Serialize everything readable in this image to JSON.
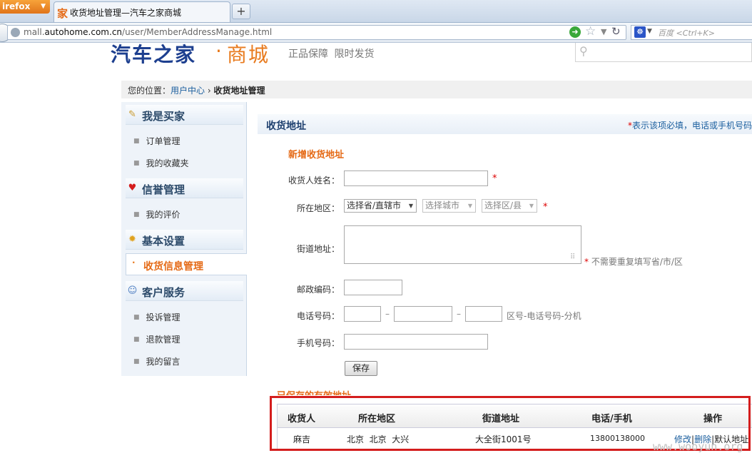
{
  "browser": {
    "menu_button": "irefox",
    "tab_title": "收货地址管理—汽车之家商城",
    "tab_favicon": "家",
    "new_tab": "+",
    "url_prefix": "mall.",
    "url_domain": "autohome.com.cn",
    "url_path": "/user/MemberAddressManage.html",
    "search_placeholder": "百度 <Ctrl+K>"
  },
  "header": {
    "logo_main": "汽车之家",
    "logo_dot": "·",
    "logo_sub": "商城",
    "slogan": "正品保障 限时发货"
  },
  "breadcrumb": {
    "prefix": "您的位置：",
    "link": "用户中心",
    "sep": " › ",
    "current": "收货地址管理"
  },
  "sidebar": {
    "sections": [
      {
        "title": "我是买家",
        "icon": "buyer-icon",
        "items": [
          "订单管理",
          "我的收藏夹"
        ]
      },
      {
        "title": "信誉管理",
        "icon": "heart-icon",
        "items": [
          "我的评价"
        ]
      },
      {
        "title": "基本设置",
        "icon": "settings-icon",
        "items": []
      },
      {
        "title": "客户服务",
        "icon": "service-icon",
        "items": [
          "投诉管理",
          "退款管理",
          "我的留言"
        ]
      }
    ],
    "active_item": "收货信息管理"
  },
  "panel": {
    "title": "收货地址",
    "note_star": "*",
    "note": "表示该项必填，电话或手机号码",
    "new_address_title": "新增收货地址",
    "form": {
      "name_label": "收货人姓名：",
      "region_label": "所在地区：",
      "province": "选择省/直辖市",
      "city": "选择城市",
      "district": "选择区/县",
      "street_label": "街道地址：",
      "street_note": "不需要重复填写省/市/区",
      "zip_label": "邮政编码：",
      "phone_label": "电话号码：",
      "phone_hint": "区号-电话号码-分机",
      "phone_dash": "–",
      "mobile_label": "手机号码：",
      "required_mark": "*",
      "save_button": "保存"
    }
  },
  "saved": {
    "title": "已保存的有效地址",
    "headers": [
      "收货人",
      "所在地区",
      "街道地址",
      "电话/手机",
      "操作"
    ],
    "rows": [
      {
        "name": "麻吉",
        "region": "北京  北京  大兴",
        "street": "大全街1001号",
        "phone": "13800138000",
        "edit": "修改",
        "delete": "删除",
        "default": "默认地址"
      }
    ]
  },
  "watermark": "www.wooyun.org",
  "colors": {
    "accent_orange": "#e56a16",
    "link_blue": "#1a5e9e",
    "highlight_red": "#d41d1d"
  }
}
